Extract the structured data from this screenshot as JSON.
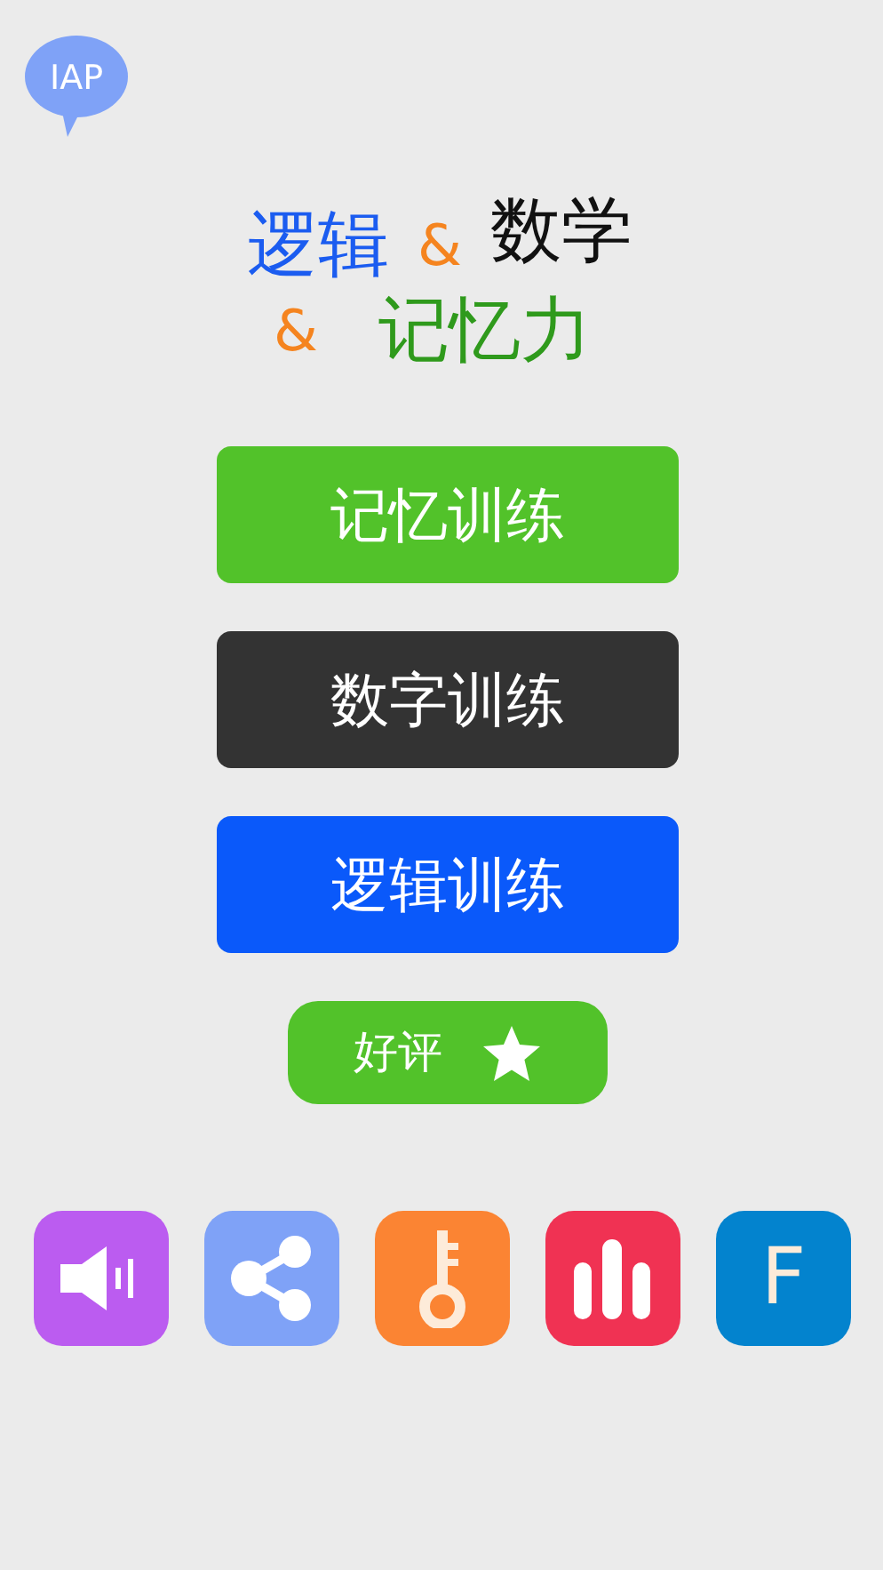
{
  "iap_badge": {
    "label": "IAP"
  },
  "title_lines": [
    [
      {
        "text": "逻辑",
        "color": "#1b5cf0"
      },
      {
        "text": "&",
        "color": "#f5841f"
      },
      {
        "text": "数学",
        "color": "#111111"
      }
    ],
    [
      {
        "text": "&",
        "color": "#f5841f"
      },
      {
        "text": "记忆力",
        "color": "#2f9a1c"
      }
    ]
  ],
  "training_buttons": [
    {
      "label": "记忆训练",
      "color": "#52c22a"
    },
    {
      "label": "数字训练",
      "color": "#333333"
    },
    {
      "label": "逻辑训练",
      "color": "#0a59fa"
    }
  ],
  "review_button": {
    "label": "好评"
  },
  "toolbar": [
    {
      "kind": "sound",
      "color": "#bb5cf0"
    },
    {
      "kind": "share",
      "color": "#7fa2f7"
    },
    {
      "kind": "key",
      "color": "#fb8433"
    },
    {
      "kind": "chart",
      "color": "#f03253"
    },
    {
      "kind": "letter",
      "color": "#0383ce",
      "label": "F"
    }
  ]
}
